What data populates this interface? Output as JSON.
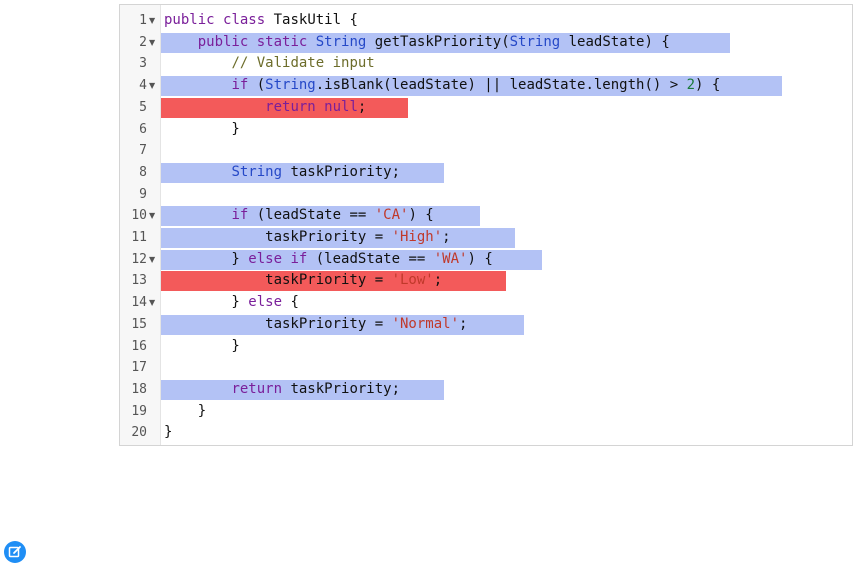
{
  "editor": {
    "lines": [
      {
        "num": "1",
        "fold": true,
        "highlight": "none",
        "hlWidth": 0,
        "tokens": [
          [
            "kw",
            "public"
          ],
          [
            "p",
            " "
          ],
          [
            "kw",
            "class"
          ],
          [
            "p",
            " TaskUtil {"
          ]
        ]
      },
      {
        "num": "2",
        "fold": true,
        "highlight": "blue",
        "hlWidth": 569,
        "tokens": [
          [
            "p",
            "    "
          ],
          [
            "kw",
            "public"
          ],
          [
            "p",
            " "
          ],
          [
            "kw",
            "static"
          ],
          [
            "p",
            " "
          ],
          [
            "type",
            "String"
          ],
          [
            "p",
            " getTaskPriority("
          ],
          [
            "type",
            "String"
          ],
          [
            "p",
            " leadState) {"
          ]
        ]
      },
      {
        "num": "3",
        "fold": false,
        "highlight": "none",
        "hlWidth": 0,
        "tokens": [
          [
            "p",
            "        "
          ],
          [
            "cmt",
            "// Validate input"
          ]
        ]
      },
      {
        "num": "4",
        "fold": true,
        "highlight": "blue",
        "hlWidth": 621,
        "tokens": [
          [
            "p",
            "        "
          ],
          [
            "kw",
            "if"
          ],
          [
            "p",
            " ("
          ],
          [
            "type",
            "String"
          ],
          [
            "p",
            ".isBlank(leadState) || leadState.length() > "
          ],
          [
            "numlit",
            "2"
          ],
          [
            "p",
            ") {"
          ]
        ]
      },
      {
        "num": "5",
        "fold": false,
        "highlight": "red",
        "hlWidth": 247,
        "tokens": [
          [
            "p",
            "            "
          ],
          [
            "kw",
            "return"
          ],
          [
            "p",
            " "
          ],
          [
            "kw",
            "null"
          ],
          [
            "p",
            ";"
          ]
        ]
      },
      {
        "num": "6",
        "fold": false,
        "highlight": "none",
        "hlWidth": 0,
        "tokens": [
          [
            "p",
            "        }"
          ]
        ]
      },
      {
        "num": "7",
        "fold": false,
        "highlight": "none",
        "hlWidth": 0,
        "tokens": []
      },
      {
        "num": "8",
        "fold": false,
        "highlight": "blue",
        "hlWidth": 283,
        "tokens": [
          [
            "p",
            "        "
          ],
          [
            "type",
            "String"
          ],
          [
            "p",
            " taskPriority;"
          ]
        ]
      },
      {
        "num": "9",
        "fold": false,
        "highlight": "none",
        "hlWidth": 0,
        "tokens": []
      },
      {
        "num": "10",
        "fold": true,
        "highlight": "blue",
        "hlWidth": 319,
        "tokens": [
          [
            "p",
            "        "
          ],
          [
            "kw",
            "if"
          ],
          [
            "p",
            " (leadState == "
          ],
          [
            "str",
            "'CA'"
          ],
          [
            "p",
            ") {"
          ]
        ]
      },
      {
        "num": "11",
        "fold": false,
        "highlight": "blue",
        "hlWidth": 354,
        "tokens": [
          [
            "p",
            "            taskPriority = "
          ],
          [
            "str",
            "'High'"
          ],
          [
            "p",
            ";"
          ]
        ]
      },
      {
        "num": "12",
        "fold": true,
        "highlight": "blue",
        "hlWidth": 381,
        "tokens": [
          [
            "p",
            "        } "
          ],
          [
            "kw",
            "else"
          ],
          [
            "p",
            " "
          ],
          [
            "kw",
            "if"
          ],
          [
            "p",
            " (leadState == "
          ],
          [
            "str",
            "'WA'"
          ],
          [
            "p",
            ") {"
          ]
        ]
      },
      {
        "num": "13",
        "fold": false,
        "highlight": "red",
        "hlWidth": 345,
        "tokens": [
          [
            "p",
            "            taskPriority = "
          ],
          [
            "str",
            "'Low'"
          ],
          [
            "p",
            ";"
          ]
        ]
      },
      {
        "num": "14",
        "fold": true,
        "highlight": "none",
        "hlWidth": 0,
        "tokens": [
          [
            "p",
            "        } "
          ],
          [
            "kw",
            "else"
          ],
          [
            "p",
            " {"
          ]
        ]
      },
      {
        "num": "15",
        "fold": false,
        "highlight": "blue",
        "hlWidth": 363,
        "tokens": [
          [
            "p",
            "            taskPriority = "
          ],
          [
            "str",
            "'Normal'"
          ],
          [
            "p",
            ";"
          ]
        ]
      },
      {
        "num": "16",
        "fold": false,
        "highlight": "none",
        "hlWidth": 0,
        "tokens": [
          [
            "p",
            "        }"
          ]
        ]
      },
      {
        "num": "17",
        "fold": false,
        "highlight": "none",
        "hlWidth": 0,
        "tokens": []
      },
      {
        "num": "18",
        "fold": false,
        "highlight": "blue",
        "hlWidth": 283,
        "tokens": [
          [
            "p",
            "        "
          ],
          [
            "kw",
            "return"
          ],
          [
            "p",
            " taskPriority;"
          ]
        ]
      },
      {
        "num": "19",
        "fold": false,
        "highlight": "none",
        "hlWidth": 0,
        "tokens": [
          [
            "p",
            "    }"
          ]
        ]
      },
      {
        "num": "20",
        "fold": false,
        "highlight": "none",
        "hlWidth": 0,
        "tokens": [
          [
            "p",
            "}"
          ]
        ]
      }
    ]
  },
  "colors": {
    "highlight_blue": "#b3c2f5",
    "highlight_red": "#f35a5a",
    "edit_icon": "#1f8ef5"
  },
  "icons": {
    "fold": "triangle-down",
    "edit": "edit-icon"
  }
}
